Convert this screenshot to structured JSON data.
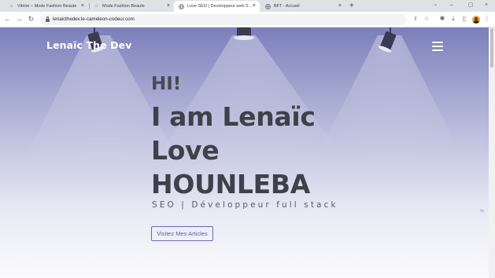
{
  "browser": {
    "tabs": [
      {
        "title": "Vitrine – Mode Fashion Beaute",
        "icon": "hanger-icon",
        "active": false
      },
      {
        "title": "Mode Fashion Beaute",
        "icon": "hanger-icon",
        "active": false
      },
      {
        "title": "Love SEO | Developpeur web SEO",
        "icon": "globe-icon",
        "active": true
      },
      {
        "title": "BFT - Accueil",
        "icon": "globe-icon",
        "active": false
      }
    ],
    "url": "lenaicthedev.le-cameleon-codeur.com"
  },
  "page": {
    "brand": "Lenaïc The Dev",
    "hero": {
      "greeting": "HI!",
      "name_lines": [
        "I am Lenaïc",
        "Love",
        "HOUNLEBA"
      ],
      "subtitle": "SEO | Développeur full stack",
      "cta": "Visitez Mes Articles"
    },
    "colors": {
      "gradient_top": "#7b7fba",
      "gradient_bottom": "#fbfbfd",
      "heading": "#3f4049",
      "accent": "#6a6bbd"
    }
  }
}
